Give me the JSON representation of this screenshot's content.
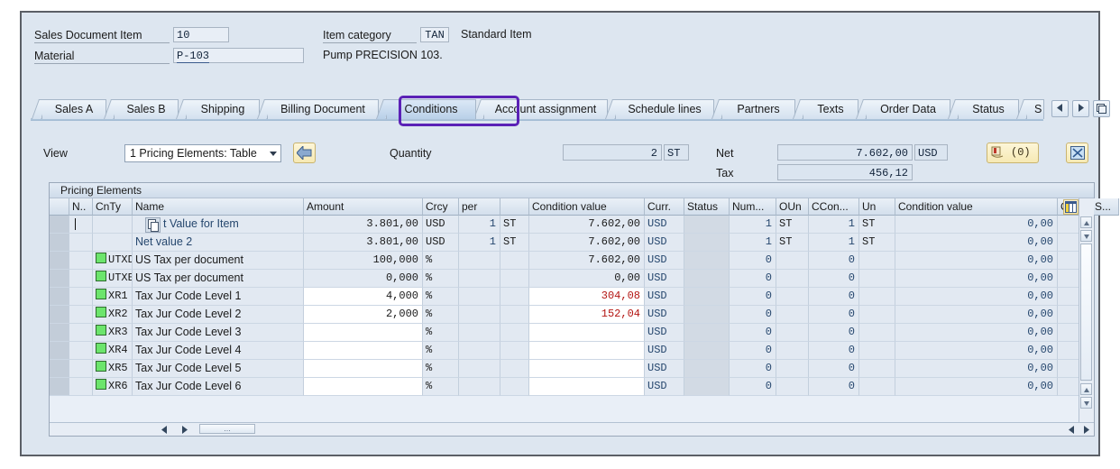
{
  "header": {
    "sales_doc_item_label": "Sales Document Item",
    "sales_doc_item_value": "10",
    "item_category_label": "Item category",
    "item_category_value": "TAN",
    "item_category_text": "Standard Item",
    "material_label": "Material",
    "material_value": "P-103",
    "material_text": "Pump PRECISION 103."
  },
  "tabs": {
    "items": [
      {
        "label": "Sales A",
        "selected": false
      },
      {
        "label": "Sales B",
        "selected": false
      },
      {
        "label": "Shipping",
        "selected": false
      },
      {
        "label": "Billing Document",
        "selected": false
      },
      {
        "label": "Conditions",
        "selected": true
      },
      {
        "label": "Account assignment",
        "selected": false
      },
      {
        "label": "Schedule lines",
        "selected": false
      },
      {
        "label": "Partners",
        "selected": false
      },
      {
        "label": "Texts",
        "selected": false
      },
      {
        "label": "Order Data",
        "selected": false
      },
      {
        "label": "Status",
        "selected": false
      },
      {
        "label": "S",
        "selected": false
      }
    ],
    "nav_prev_icon": "triangle-left-icon",
    "nav_next_icon": "triangle-right-icon",
    "nav_list_icon": "tab-list-icon"
  },
  "toolbar": {
    "view_label": "View",
    "view_value": "1 Pricing Elements: Table",
    "back_icon": "back-arrow-icon",
    "quantity_label": "Quantity",
    "quantity_value": "2",
    "quantity_unit": "ST",
    "net_label": "Net",
    "net_value": "7.602,00",
    "net_currency": "USD",
    "tax_label": "Tax",
    "tax_value": "456,12",
    "message_icon": "message-log-icon",
    "message_count": "(0)",
    "fullscreen_icon": "expand-icon"
  },
  "grid": {
    "title": "Pricing Elements",
    "columns": [
      {
        "key": "select",
        "label": ""
      },
      {
        "key": "n",
        "label": "N.."
      },
      {
        "key": "cnty",
        "label": "CnTy"
      },
      {
        "key": "name",
        "label": "Name"
      },
      {
        "key": "amount",
        "label": "Amount"
      },
      {
        "key": "crcy",
        "label": "Crcy"
      },
      {
        "key": "per",
        "label": "per"
      },
      {
        "key": "peruom",
        "label": ""
      },
      {
        "key": "condvalue",
        "label": "Condition value"
      },
      {
        "key": "curr",
        "label": "Curr."
      },
      {
        "key": "status",
        "label": "Status"
      },
      {
        "key": "num",
        "label": "Num..."
      },
      {
        "key": "oun",
        "label": "OUn"
      },
      {
        "key": "ccon",
        "label": "CCon..."
      },
      {
        "key": "un",
        "label": "Un"
      },
      {
        "key": "condvalue2",
        "label": "Condition value"
      },
      {
        "key": "cdcur",
        "label": "CdCur"
      },
      {
        "key": "s",
        "label": "S..."
      }
    ],
    "column_config_icon": "table-settings-icon",
    "rows": [
      {
        "n": "|",
        "cnty": "",
        "has_status_box": false,
        "has_copy_icon": true,
        "name": "t Value for Item",
        "name_style": "blue",
        "amount": "3.801,00",
        "amount_editable": false,
        "crcy": "USD",
        "per": "1",
        "peruom": "ST",
        "condvalue": "7.602,00",
        "condvalue_red": false,
        "condvalue_editable": false,
        "curr": "USD",
        "status": "",
        "num": "1",
        "oun": "ST",
        "ccon": "1",
        "un": "ST",
        "condvalue2": "0,00",
        "cdcur": "",
        "checked": false
      },
      {
        "n": "",
        "cnty": "",
        "has_status_box": false,
        "has_copy_icon": false,
        "name": "Net value 2",
        "name_style": "blue",
        "amount": "3.801,00",
        "amount_editable": false,
        "crcy": "USD",
        "per": "1",
        "peruom": "ST",
        "condvalue": "7.602,00",
        "condvalue_red": false,
        "condvalue_editable": false,
        "curr": "USD",
        "status": "",
        "num": "1",
        "oun": "ST",
        "ccon": "1",
        "un": "ST",
        "condvalue2": "0,00",
        "cdcur": "",
        "checked": false
      },
      {
        "n": "",
        "cnty": "UTXD",
        "has_status_box": true,
        "has_copy_icon": false,
        "name": "US Tax per document",
        "name_style": "dark",
        "amount": "100,000",
        "amount_editable": false,
        "crcy": "%",
        "per": "",
        "peruom": "",
        "condvalue": "7.602,00",
        "condvalue_red": false,
        "condvalue_editable": false,
        "curr": "USD",
        "status": "",
        "num": "0",
        "oun": "",
        "ccon": "0",
        "un": "",
        "condvalue2": "0,00",
        "cdcur": "",
        "checked": true
      },
      {
        "n": "",
        "cnty": "UTXE",
        "has_status_box": true,
        "has_copy_icon": false,
        "name": "US Tax per document",
        "name_style": "dark",
        "amount": "0,000",
        "amount_editable": false,
        "crcy": "%",
        "per": "",
        "peruom": "",
        "condvalue": "0,00",
        "condvalue_red": false,
        "condvalue_editable": false,
        "curr": "USD",
        "status": "",
        "num": "0",
        "oun": "",
        "ccon": "0",
        "un": "",
        "condvalue2": "0,00",
        "cdcur": "",
        "checked": true
      },
      {
        "n": "",
        "cnty": "XR1",
        "has_status_box": true,
        "has_copy_icon": false,
        "name": "Tax Jur Code Level 1",
        "name_style": "dark",
        "amount": "4,000",
        "amount_editable": true,
        "crcy": "%",
        "per": "",
        "peruom": "",
        "condvalue": "304,08",
        "condvalue_red": true,
        "condvalue_editable": true,
        "curr": "USD",
        "status": "",
        "num": "0",
        "oun": "",
        "ccon": "0",
        "un": "",
        "condvalue2": "0,00",
        "cdcur": "",
        "checked": false
      },
      {
        "n": "",
        "cnty": "XR2",
        "has_status_box": true,
        "has_copy_icon": false,
        "name": "Tax Jur Code Level 2",
        "name_style": "dark",
        "amount": "2,000",
        "amount_editable": true,
        "crcy": "%",
        "per": "",
        "peruom": "",
        "condvalue": "152,04",
        "condvalue_red": true,
        "condvalue_editable": true,
        "curr": "USD",
        "status": "",
        "num": "0",
        "oun": "",
        "ccon": "0",
        "un": "",
        "condvalue2": "0,00",
        "cdcur": "",
        "checked": false
      },
      {
        "n": "",
        "cnty": "XR3",
        "has_status_box": true,
        "has_copy_icon": false,
        "name": "Tax Jur Code Level 3",
        "name_style": "dark",
        "amount": "",
        "amount_editable": true,
        "crcy": "%",
        "per": "",
        "peruom": "",
        "condvalue": "",
        "condvalue_red": false,
        "condvalue_editable": true,
        "curr": "USD",
        "status": "",
        "num": "0",
        "oun": "",
        "ccon": "0",
        "un": "",
        "condvalue2": "0,00",
        "cdcur": "",
        "checked": false
      },
      {
        "n": "",
        "cnty": "XR4",
        "has_status_box": true,
        "has_copy_icon": false,
        "name": "Tax Jur Code Level 4",
        "name_style": "dark",
        "amount": "",
        "amount_editable": true,
        "crcy": "%",
        "per": "",
        "peruom": "",
        "condvalue": "",
        "condvalue_red": false,
        "condvalue_editable": true,
        "curr": "USD",
        "status": "",
        "num": "0",
        "oun": "",
        "ccon": "0",
        "un": "",
        "condvalue2": "0,00",
        "cdcur": "",
        "checked": false
      },
      {
        "n": "",
        "cnty": "XR5",
        "has_status_box": true,
        "has_copy_icon": false,
        "name": "Tax Jur Code Level 5",
        "name_style": "dark",
        "amount": "",
        "amount_editable": true,
        "crcy": "%",
        "per": "",
        "peruom": "",
        "condvalue": "",
        "condvalue_red": false,
        "condvalue_editable": true,
        "curr": "USD",
        "status": "",
        "num": "0",
        "oun": "",
        "ccon": "0",
        "un": "",
        "condvalue2": "0,00",
        "cdcur": "",
        "checked": false
      },
      {
        "n": "",
        "cnty": "XR6",
        "has_status_box": true,
        "has_copy_icon": false,
        "name": "Tax Jur Code Level 6",
        "name_style": "dark",
        "amount": "",
        "amount_editable": true,
        "crcy": "%",
        "per": "",
        "peruom": "",
        "condvalue": "",
        "condvalue_red": false,
        "condvalue_editable": true,
        "curr": "USD",
        "status": "",
        "num": "0",
        "oun": "",
        "ccon": "0",
        "un": "",
        "condvalue2": "0,00",
        "cdcur": "",
        "checked": false
      }
    ],
    "hscroll_thumb_label": "..."
  },
  "colors": {
    "highlight": "#5b21b6",
    "status_green": "#6ce56c",
    "negative_red": "#b31512",
    "field_blue": "#26476e"
  }
}
